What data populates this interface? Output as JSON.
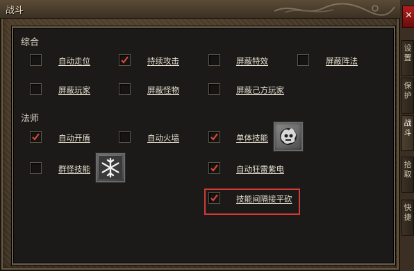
{
  "window": {
    "title": "战斗"
  },
  "sections": {
    "general": "综合",
    "mage": "法师"
  },
  "options": [
    {
      "label": "自动走位",
      "checked": false
    },
    {
      "label": "持续攻击",
      "checked": true
    },
    {
      "label": "屏蔽特效",
      "checked": false
    },
    {
      "label": "屏蔽阵法",
      "checked": false
    },
    {
      "label": "屏蔽玩家",
      "checked": false
    },
    {
      "label": "屏蔽怪物",
      "checked": false
    },
    {
      "label": "屏蔽己方玩家",
      "checked": false
    },
    {
      "label": "自动开盾",
      "checked": true
    },
    {
      "label": "自动火墙",
      "checked": false
    },
    {
      "label": "单体技能",
      "checked": true,
      "skill_icon": "flame-skull-icon"
    },
    {
      "label": "群怪技能",
      "checked": false,
      "skill_icon": "snowflake-icon"
    },
    {
      "label": "自动狂雷紫电",
      "checked": true
    },
    {
      "label": "技能间隔接平砍",
      "checked": true
    }
  ],
  "side_tabs": [
    {
      "label": "设置",
      "active": false
    },
    {
      "label": "保护",
      "active": false
    },
    {
      "label": "战斗",
      "active": true
    },
    {
      "label": "拾取",
      "active": false
    },
    {
      "label": "快捷",
      "active": false
    }
  ],
  "close_label": "✕",
  "colors": {
    "checkmark": "#d9483a",
    "highlight_box": "#d23a36",
    "close_button": "#b01e1e"
  }
}
